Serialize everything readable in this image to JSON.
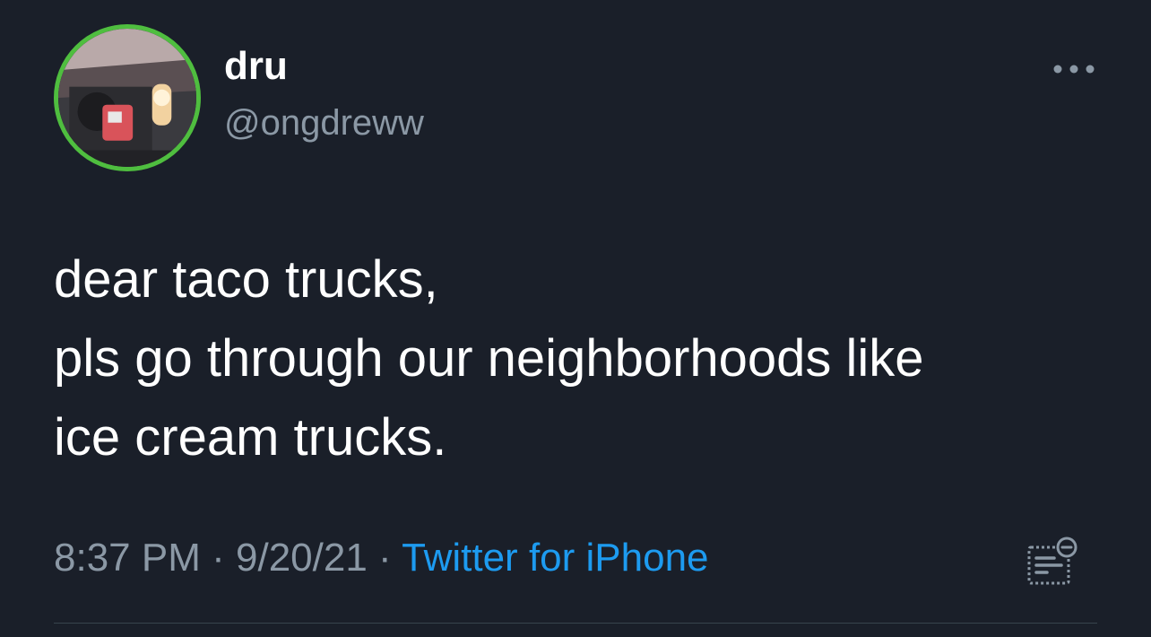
{
  "user": {
    "display_name": "dru",
    "handle": "@ongdreww",
    "avatar_ring_color": "#4fbe3f"
  },
  "tweet": {
    "lines": [
      "dear taco trucks,",
      "pls go through our neighborhoods like",
      "ice cream trucks."
    ]
  },
  "meta": {
    "time": "8:37 PM",
    "separator": "·",
    "date": "9/20/21",
    "source": "Twitter for iPhone",
    "source_color": "#1d9bf0"
  },
  "icons": {
    "more": "more-horizontal-icon",
    "analytics": "tweet-analytics-icon"
  },
  "colors": {
    "background": "#1a1f29",
    "text": "#ffffff",
    "secondary_text": "#8b98a5",
    "divider": "#38444d"
  }
}
